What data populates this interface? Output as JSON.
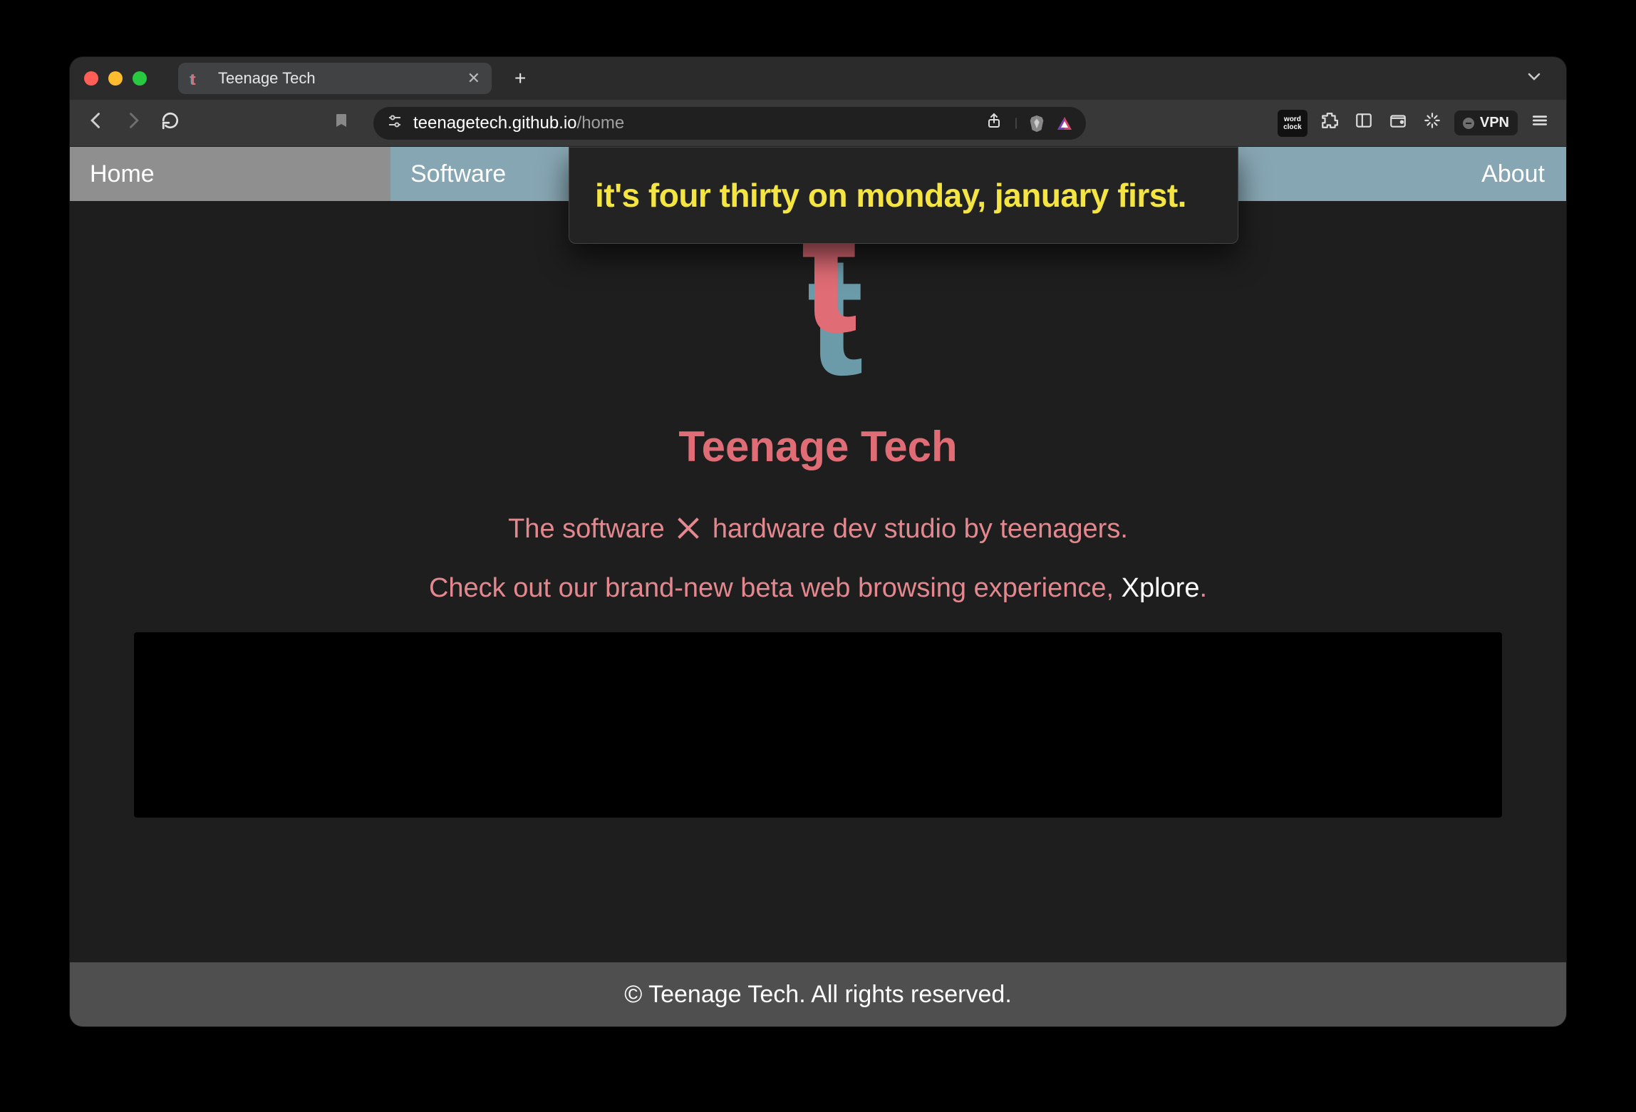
{
  "browser": {
    "tab": {
      "title": "Teenage Tech"
    },
    "url_host": "teenagetech.github.io",
    "url_path": "/home",
    "word_clock_label": "word clock",
    "vpn_label": "VPN",
    "popover_text": "it's four thirty on monday, january first."
  },
  "site": {
    "nav": {
      "home": "Home",
      "software": "Software",
      "about": "About"
    },
    "title": "Teenage Tech",
    "tagline_pre": "The software ",
    "tagline_post": " hardware dev studio by teenagers.",
    "cta_pre": "Check out our brand-new beta web browsing experience, ",
    "cta_link": "Xplore",
    "cta_post": ".",
    "footer": "© Teenage Tech. All rights reserved."
  }
}
